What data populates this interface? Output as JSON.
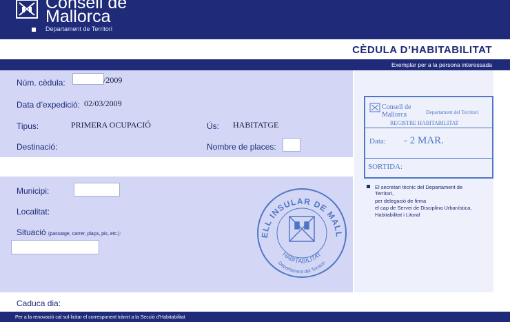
{
  "header": {
    "brand_line1": "Consell de",
    "brand_line2": "Mallorca",
    "department": "Departament de Territori"
  },
  "document": {
    "title": "CÈDULA D’HABITABILITAT",
    "copy_note": "Exemplar per a la persona interessada"
  },
  "fields": {
    "num_cedula_label": "Núm. cèdula:",
    "num_cedula_suffix": "/2009",
    "data_label": "Data d’expedició:",
    "data_value": "02/03/2009",
    "tipus_label": "Tipus:",
    "tipus_value": "PRIMERA OCUPACIÓ",
    "us_label": "Ús:",
    "us_value": "HABITATGE",
    "destinacio_label": "Destinació:",
    "nombre_places_label": "Nombre de places:",
    "municipi_label": "Municipi:",
    "localitat_label": "Localitat:",
    "situacio_label": "Situació",
    "situacio_hint": "(passatge, carrer, plaça, pis, etc.):",
    "caduca_label": "Caduca dia:"
  },
  "stamp": {
    "org1": "Consell de",
    "org2": "Mallorca",
    "dept": "Departament del Territori",
    "registry": "REGISTRE HABITABILITAT",
    "data_label": "Data:",
    "data_value": "- 2 MAR.",
    "sortida_label": "SORTIDA:"
  },
  "seal": {
    "outer_text": "CONSELL INSULAR DE MALLORCA",
    "inner_text": "HABITABILITAT",
    "dept_text": "Departament del Territori"
  },
  "signature_note": {
    "line1": "El secretari tècnic del Departament de",
    "line2": "Territori,",
    "line3": "per delegació de firma",
    "line4": "el cap de Servei de Disciplina Urbanística,",
    "line5": "Habitabilitat i Litoral"
  },
  "footer": {
    "text": "Per a la renovació cal sol·licitar el corresponent tràmit a la Secció d’Habitabilitat"
  },
  "colors": {
    "navy": "#1f2a78",
    "panel": "#d3d7f5",
    "stamp_blue": "#4d77c4"
  }
}
